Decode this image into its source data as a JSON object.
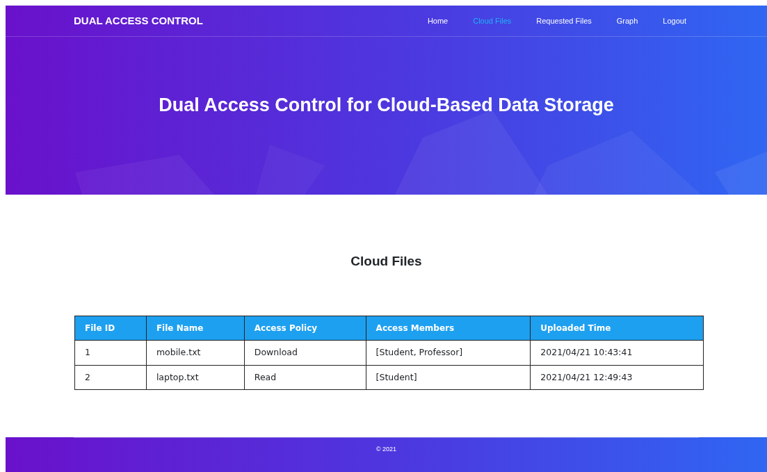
{
  "navbar": {
    "brand": "DUAL ACCESS CONTROL",
    "items": [
      {
        "label": "Home",
        "selected": false
      },
      {
        "label": "Cloud Files",
        "selected": true
      },
      {
        "label": "Requested Files",
        "selected": false
      },
      {
        "label": "Graph",
        "selected": false
      },
      {
        "label": "Logout",
        "selected": false
      }
    ]
  },
  "hero": {
    "title": "Dual Access Control for Cloud-Based Data Storage"
  },
  "section": {
    "title": "Cloud Files"
  },
  "table": {
    "columns": [
      "File ID",
      "File Name",
      "Access Policy",
      "Access Members",
      "Uploaded Time"
    ],
    "rows": [
      [
        "1",
        "mobile.txt",
        "Download",
        "[Student, Professor]",
        "2021/04/21 10:43:41"
      ],
      [
        "2",
        "laptop.txt",
        "Read",
        "[Student]",
        "2021/04/21 12:49:43"
      ]
    ]
  },
  "footer": {
    "copyright": "© 2021"
  }
}
